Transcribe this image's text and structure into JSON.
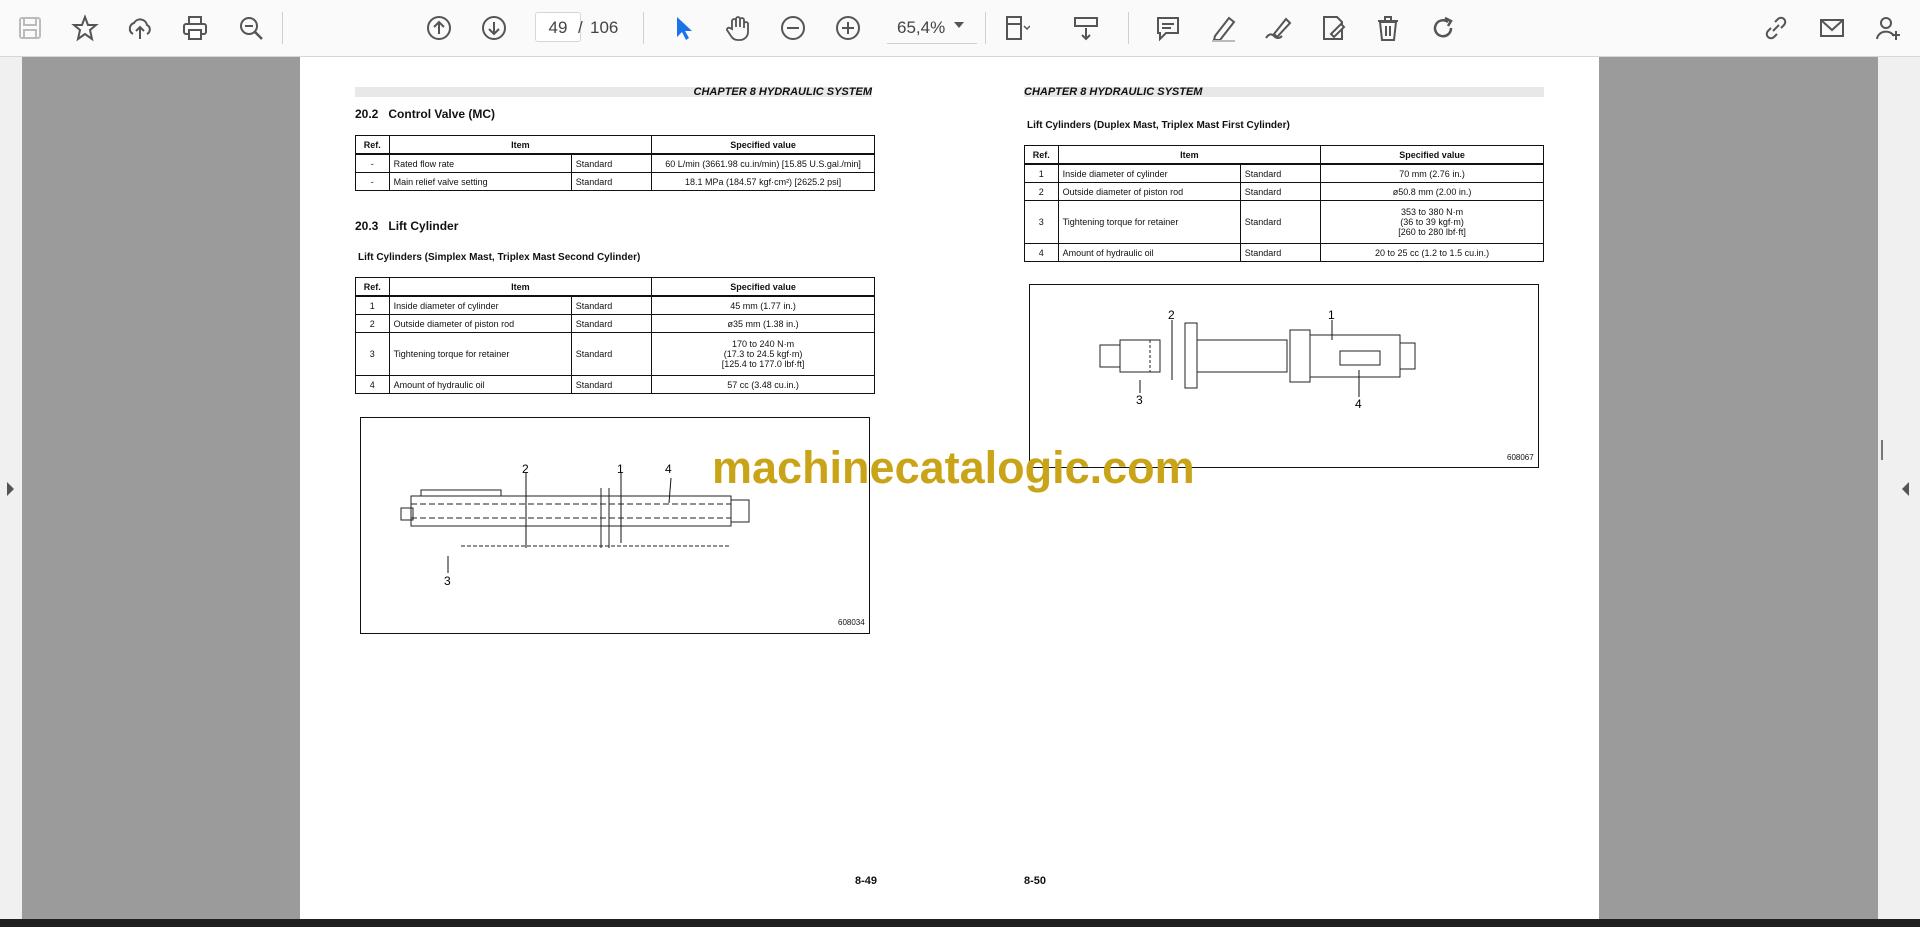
{
  "toolbar": {
    "icons": [
      "save-icon",
      "bookmark-star-icon",
      "upload-cloud-icon",
      "print-icon",
      "zoom-search-icon",
      "page-up-icon",
      "page-down-icon",
      "select-cursor-icon",
      "hand-pan-icon",
      "zoom-out-icon",
      "zoom-in-icon",
      "fit-page-icon",
      "scroll-mode-icon",
      "comment-icon",
      "highlight-pen-icon",
      "sign-icon",
      "edit-pdf-icon",
      "trash-icon",
      "rotate-icon",
      "share-link-icon",
      "mail-icon",
      "add-user-icon"
    ],
    "current_page": "49",
    "page_separator": "/",
    "total_pages": "106",
    "zoom": "65,4%",
    "accent_color": "#1a73e8"
  },
  "left_page": {
    "chapter_header": "CHAPTER 8 HYDRAULIC SYSTEM",
    "section1": {
      "number": "20.2",
      "title": "Control Valve (MC)"
    },
    "table1": {
      "headers": [
        "Ref.",
        "Item",
        "Specified value"
      ],
      "rows": [
        [
          "-",
          "Rated flow rate",
          "Standard",
          "60 L/min (3661.98 cu.in/min) [15.85 U.S.gal./min]"
        ],
        [
          "-",
          "Main relief valve setting",
          "Standard",
          "18.1 MPa (184.57 kgf·cm²) [2625.2 psi]"
        ]
      ]
    },
    "section2": {
      "number": "20.3",
      "title": "Lift Cylinder"
    },
    "subtitle": "Lift Cylinders (Simplex Mast, Triplex Mast Second Cylinder)",
    "table2": {
      "headers": [
        "Ref.",
        "Item",
        "Specified value"
      ],
      "rows": [
        [
          "1",
          "Inside diameter of cylinder",
          "Standard",
          "45 mm (1.77 in.)"
        ],
        [
          "2",
          "Outside diameter of piston rod",
          "Standard",
          "ø35 mm (1.38 in.)"
        ],
        [
          "3",
          "Tightening torque for retainer",
          "Standard",
          "170 to 240 N·m",
          "(17.3 to 24.5 kgf·m)",
          "[125.4 to 177.0 lbf·ft]"
        ],
        [
          "4",
          "Amount of hydraulic oil",
          "Standard",
          "57 cc (3.48 cu.in.)"
        ]
      ]
    },
    "figure": {
      "callouts": [
        "2",
        "1",
        "4",
        "3"
      ],
      "code": "608034"
    },
    "page_number": "8-49"
  },
  "right_page": {
    "chapter_header": "CHAPTER 8 HYDRAULIC SYSTEM",
    "subtitle": "Lift Cylinders (Duplex Mast, Triplex Mast First Cylinder)",
    "table": {
      "headers": [
        "Ref.",
        "Item",
        "Specified value"
      ],
      "rows": [
        [
          "1",
          "Inside diameter of cylinder",
          "Standard",
          "70 mm (2.76 in.)"
        ],
        [
          "2",
          "Outside diameter of piston rod",
          "Standard",
          "ø50.8 mm (2.00 in.)"
        ],
        [
          "3",
          "Tightening torque for retainer",
          "Standard",
          "353 to 380 N·m",
          "(36 to 39 kgf·m)",
          "[260 to 280 lbf·ft]"
        ],
        [
          "4",
          "Amount of hydraulic oil",
          "Standard",
          "20 to 25 cc (1.2 to 1.5 cu.in.)"
        ]
      ]
    },
    "figure": {
      "callouts": [
        "2",
        "1",
        "3",
        "4"
      ],
      "code": "608067"
    },
    "page_number": "8-50"
  },
  "watermark": "machinecatalogic.com"
}
